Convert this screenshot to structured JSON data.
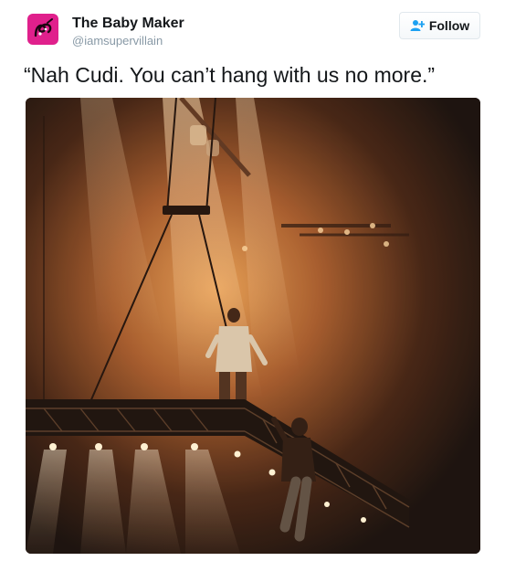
{
  "tweet": {
    "author": {
      "name": "The Baby Maker",
      "handle": "@iamsupervillain",
      "avatar_icon": "avatar-pink-logo-icon",
      "avatar_color": "#e0208c"
    },
    "follow": {
      "label": "Follow",
      "icon": "add-user-icon",
      "icon_color": "#1da1f2"
    },
    "text": "“Nah Cudi. You can’t hang with us no more.”",
    "media": {
      "alt": "Performer standing on a suspended stage platform under orange lights while another performer climbs the edge",
      "accent_color": "#e08a3a"
    }
  }
}
